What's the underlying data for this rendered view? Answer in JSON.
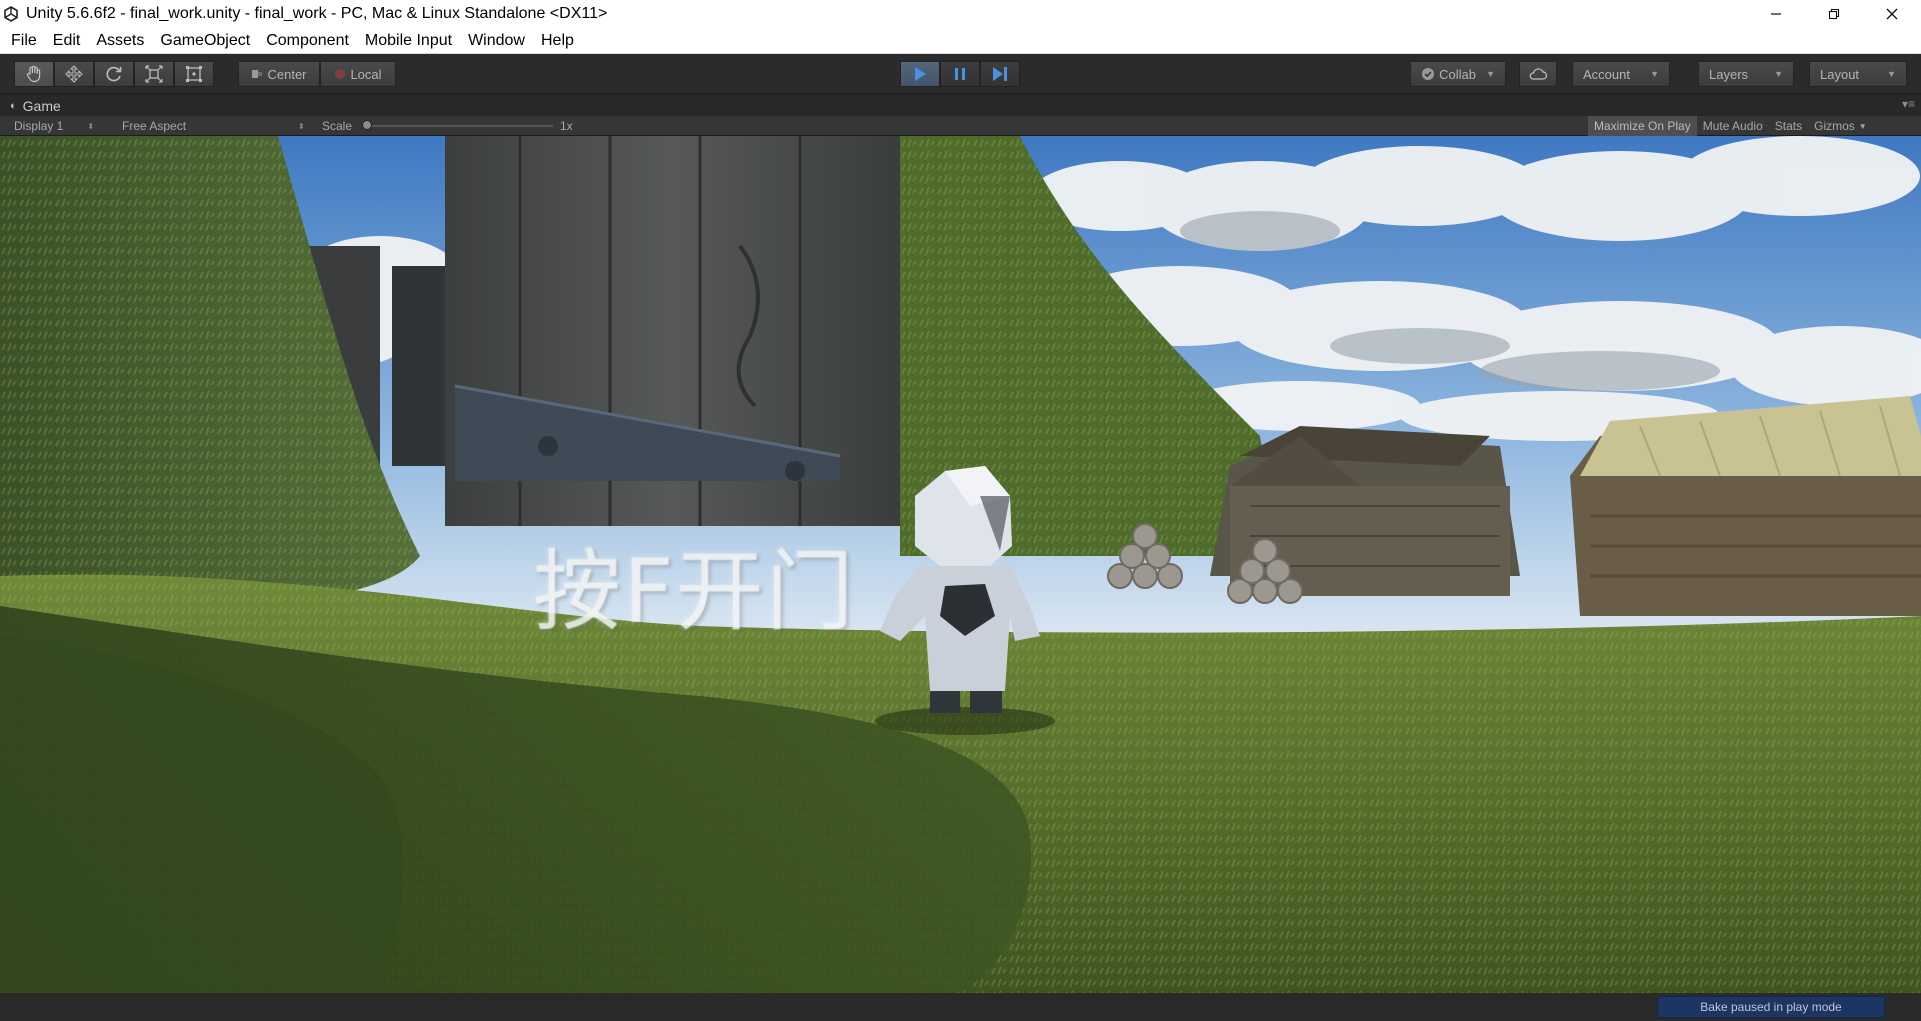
{
  "window": {
    "title": "Unity 5.6.6f2 - final_work.unity - final_work - PC, Mac & Linux Standalone <DX11>",
    "icon": "unity-logo-icon",
    "controls": [
      "minimize-icon",
      "restore-icon",
      "close-icon"
    ]
  },
  "menu": [
    "File",
    "Edit",
    "Assets",
    "GameObject",
    "Component",
    "Mobile Input",
    "Window",
    "Help"
  ],
  "toolbar": {
    "tools": [
      {
        "name": "hand-tool",
        "icon": "hand-icon"
      },
      {
        "name": "move-tool",
        "icon": "move-arrows-icon"
      },
      {
        "name": "rotate-tool",
        "icon": "rotate-icon"
      },
      {
        "name": "scale-tool",
        "icon": "scale-icon"
      },
      {
        "name": "rect-tool",
        "icon": "rect-transform-icon"
      }
    ],
    "pivot": "Center",
    "space": "Local",
    "play_controls": [
      "play-icon",
      "pause-icon",
      "step-icon"
    ],
    "collab": "Collab",
    "cloud_icon": "cloud-icon",
    "account": "Account",
    "layers": "Layers",
    "layout": "Layout"
  },
  "game_view": {
    "tab_label": "Game",
    "display": "Display 1",
    "aspect": "Free Aspect",
    "scale_label": "Scale",
    "scale_value": "1x",
    "maximize_on_play": "Maximize On Play",
    "mute_audio": "Mute Audio",
    "stats": "Stats",
    "gizmos": "Gizmos"
  },
  "scene": {
    "prompt_text": "按F开门"
  },
  "status": {
    "bake": "Bake paused in play mode"
  },
  "colors": {
    "toolbar_bg": "#2b2b2b",
    "play_active": "#4a90e2",
    "bake_bar": "#1d3563"
  }
}
